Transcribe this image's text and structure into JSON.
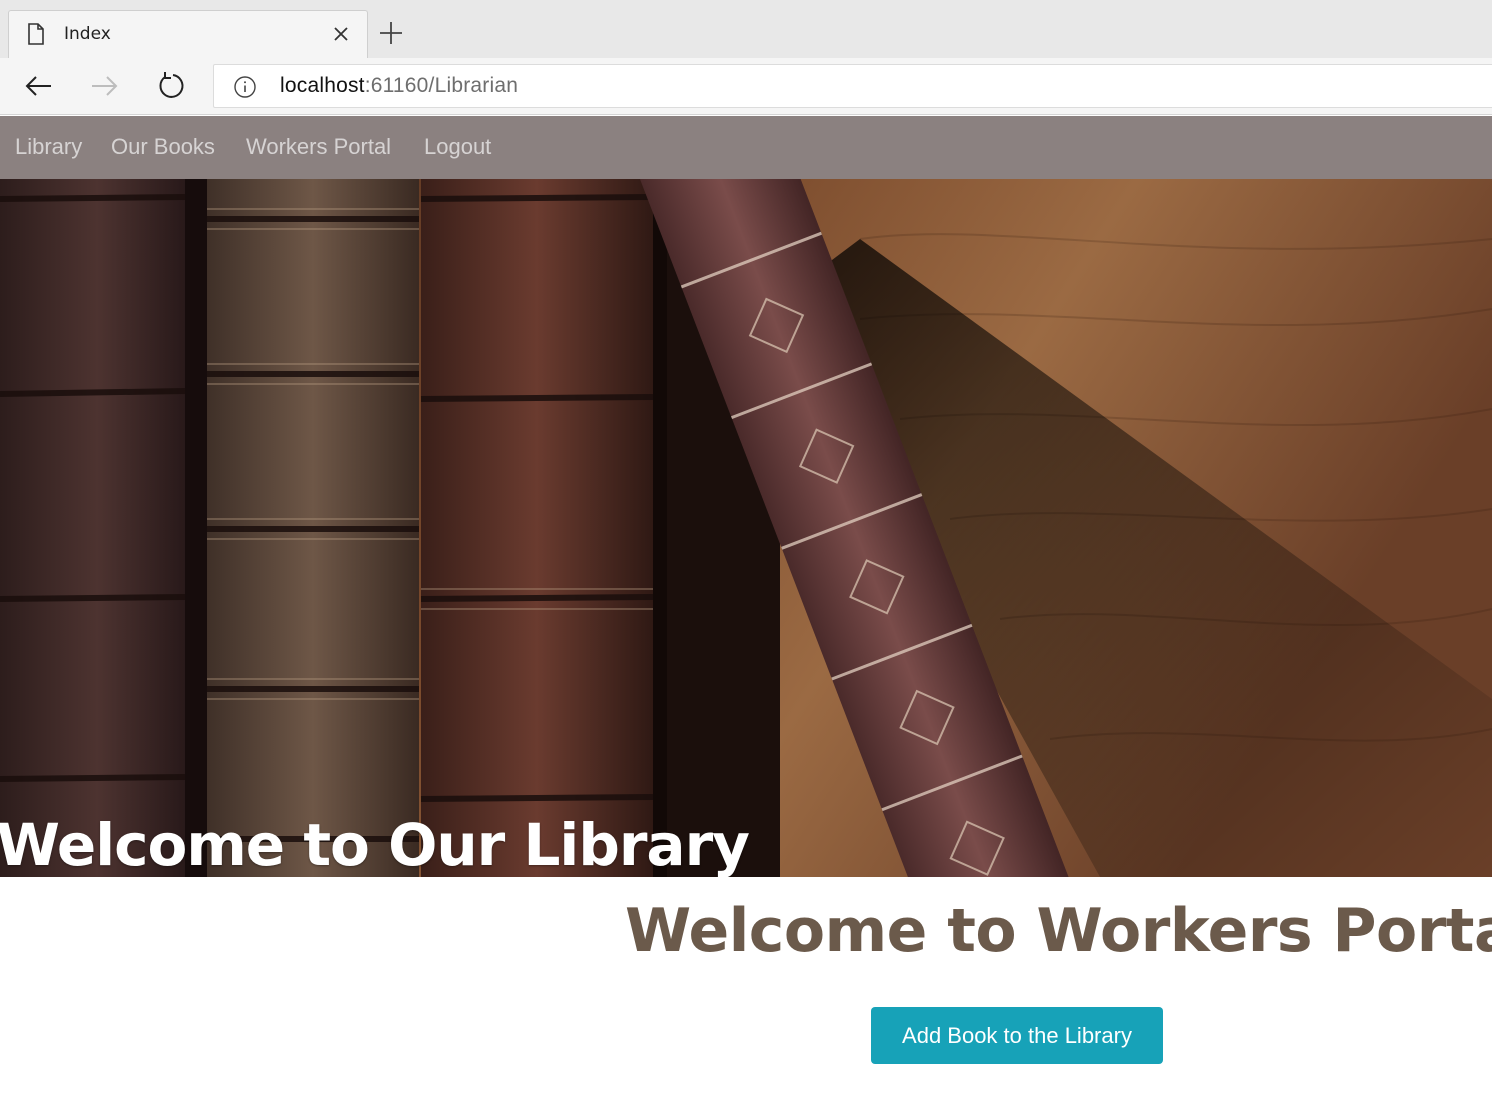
{
  "browser": {
    "tab_title": "Index",
    "url_host": "localhost",
    "url_rest": ":61160/Librarian"
  },
  "nav": {
    "items": [
      {
        "label": "Library"
      },
      {
        "label": "Our Books"
      },
      {
        "label": "Workers Portal"
      },
      {
        "label": "Logout"
      }
    ]
  },
  "hero": {
    "title": "Welcome to Our Library"
  },
  "main": {
    "title": "Welcome to Workers Portal",
    "add_button_label": "Add Book to the Library"
  },
  "colors": {
    "nav_background": "#8b8180",
    "heading_color": "#6b5a4b",
    "button_color": "#17a2b8"
  }
}
